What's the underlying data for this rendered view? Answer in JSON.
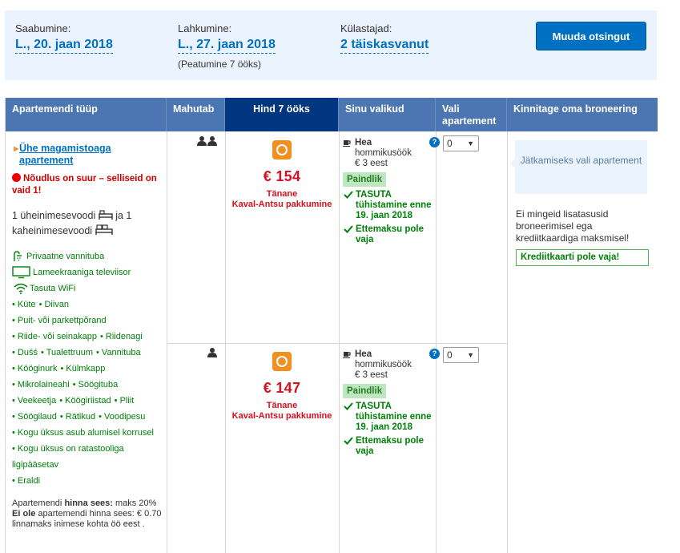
{
  "search": {
    "checkin_label": "Saabumine:",
    "checkin_value": "L., 20. jaan 2018",
    "checkout_label": "Lahkumine:",
    "checkout_value": "L., 27. jaan 2018",
    "stay_note": "(Peatumine 7 ööks)",
    "guests_label": "Külastajad:",
    "guests_value": "2 täiskasvanut",
    "modify_button": "Muuda otsingut"
  },
  "table": {
    "headers": {
      "type": "Apartemendi tüüp",
      "capacity": "Mahutab",
      "price": "Hind 7 ööks",
      "choices": "Sinu valikud",
      "select": "Vali apartement",
      "confirm": "Kinnitage oma broneering"
    }
  },
  "room": {
    "name": "Ühe magamistoaga apartement",
    "demand": "Nõudlus on suur – selliseid on vaid 1!",
    "beds_text1": "1 üheinimesevoodi",
    "beds_text2": "ja 1",
    "beds_text3": "kaheinimesevoodi",
    "facilities": {
      "bathroom": "Privaatne vannituba",
      "tv": "Lameekraaniga televiisor",
      "wifi": "Tasuta WiFi",
      "items": [
        [
          "Küte",
          "Diivan"
        ],
        [
          "Puit- või parkettpõrand"
        ],
        [
          "Riide- või seinakapp",
          "Riidenagi"
        ],
        [
          "Duśś",
          "Tualettruum",
          "Vannituba"
        ],
        [
          "Kööginurk",
          "Külmkapp"
        ],
        [
          "Mikrolaineahi",
          "Söögituba"
        ],
        [
          "Veekeetja",
          "Köögiriistad",
          "Pliit"
        ],
        [
          "Söögilaud",
          "Rätikud",
          "Voodipesu"
        ],
        [
          "Kogu üksus asub alumisel korrusel"
        ],
        [
          "Kogu üksus on ratastooliga"
        ]
      ],
      "accessible_cont": "ligipääsetav",
      "last": "Eraldi"
    },
    "included_prefix": "Apartemendi ",
    "included_bold": "hinna sees:",
    "included_rest": " maks 20%",
    "excluded_bold": "Ei ole",
    "excluded_rest": " apartemendi hinna sees: € 0.70 linnamaks inimese kohta öö eest ."
  },
  "offers": [
    {
      "guests": 2,
      "price": "€ 154",
      "deal_line1": "Tänane",
      "deal_line2": "Kaval-Antsu pakkumine",
      "meal_title": "Hea",
      "meal_sub": "hommikusöök",
      "meal_price": "€ 3 eest",
      "flex": "Paindlik",
      "free_cancel": "TASUTA tühistamine enne 19. jaan 2018",
      "no_prepay": "Ettemaksu pole vaja",
      "select_value": "0"
    },
    {
      "guests": 1,
      "price": "€ 147",
      "deal_line1": "Tänane",
      "deal_line2": "Kaval-Antsu pakkumine",
      "meal_title": "Hea",
      "meal_sub": "hommikusöök",
      "meal_price": "€ 3 eest",
      "flex": "Paindlik",
      "free_cancel": "TASUTA tühistamine enne 19. jaan 2018",
      "no_prepay": "Ettemaksu pole vaja",
      "select_value": "0"
    }
  ],
  "confirm": {
    "prompt": "Jätkamiseks vali apartement",
    "no_fees": "Ei mingeid lisatasusid broneerimisel ega krediitkaardiga maksmisel!",
    "no_card": "Krediitkaarti pole vaja!"
  },
  "colors": {
    "accent": "#0071c2",
    "header": "#4c76b2",
    "price_header": "#003580",
    "price": "#d4111e",
    "green": "#008009"
  }
}
